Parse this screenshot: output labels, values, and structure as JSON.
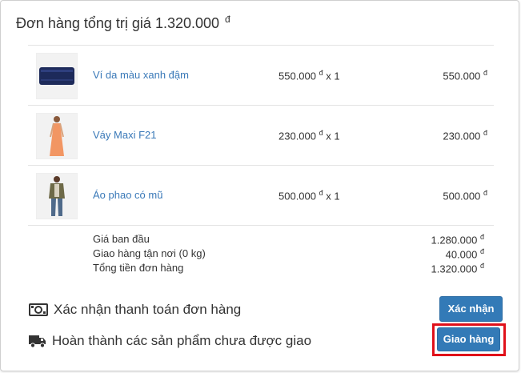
{
  "order": {
    "title_prefix": "Đơn hàng tổng trị giá",
    "title_amount": "1.320.000",
    "currency": "đ"
  },
  "items": [
    {
      "name": "Ví da màu xanh đậm",
      "unit_price": "550.000",
      "qty": "x 1",
      "total": "550.000",
      "image": "wallet-image"
    },
    {
      "name": "Váy Maxi F21",
      "unit_price": "230.000",
      "qty": "x 1",
      "total": "230.000",
      "image": "maxi-dress-image"
    },
    {
      "name": "Áo phao có mũ",
      "unit_price": "500.000",
      "qty": "x 1",
      "total": "500.000",
      "image": "hooded-jacket-image"
    }
  ],
  "summary": {
    "subtotal_label": "Giá ban đầu",
    "subtotal_value": "1.280.000",
    "shipping_label": "Giao hàng tận nơi (0 kg)",
    "shipping_value": "40.000",
    "total_label": "Tổng tiền đơn hàng",
    "total_value": "1.320.000"
  },
  "actions": {
    "payment_text": "Xác nhận thanh toán đơn hàng",
    "payment_icon": "money-icon",
    "confirm_button": "Xác nhận",
    "delivery_text": "Hoàn thành các sản phẩm chưa được giao",
    "delivery_icon": "truck-icon",
    "ship_button": "Giao hàng"
  },
  "colors": {
    "link": "#3a79b8",
    "button": "#337ab7",
    "highlight": "#e0101a"
  }
}
